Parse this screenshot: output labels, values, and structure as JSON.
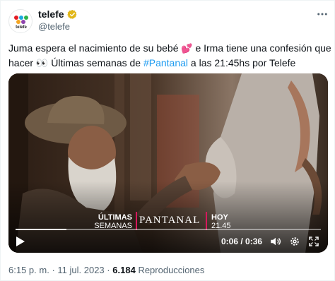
{
  "account": {
    "name": "telefe",
    "handle": "@telefe",
    "avatar_text": "telefe",
    "avatar_icon": "telefe-logo-icon",
    "verified_icon": "gold-verified-badge-icon"
  },
  "more_icon": "more-horizontal-icon",
  "tweet": {
    "line1_a": "Juma espera el nacimiento de su bebé ",
    "line1_emoji": "💕",
    "line1_b": " e Irma tiene una confesión que",
    "line2_a": "hacer ",
    "line2_emoji": "👀",
    "line2_b": " Últimas semanas de ",
    "hashtag": "#Pantanal",
    "line2_c": " a las 21:45hs por Telefe"
  },
  "video": {
    "overlay_left_1": "ÚLTIMAS",
    "overlay_left_2": "SEMANAS",
    "show_title": "PANTANAL",
    "overlay_right_1": "HOY",
    "overlay_right_2": "21.45",
    "time": "0:06 / 0:36",
    "progress": 0.1667,
    "play_icon": "play-icon",
    "volume_icon": "volume-icon",
    "settings_icon": "settings-gear-icon",
    "fullscreen_icon": "fullscreen-icon",
    "accent_color": "#d7185d"
  },
  "meta": {
    "time": "6:15 p. m.",
    "separator1": "·",
    "date": "11 jul. 2023",
    "separator2": "·",
    "views": "6.184",
    "views_label": "Reproducciones"
  },
  "colors": {
    "text": "#0f1419",
    "secondary": "#536471",
    "link": "#1d9bf0"
  }
}
